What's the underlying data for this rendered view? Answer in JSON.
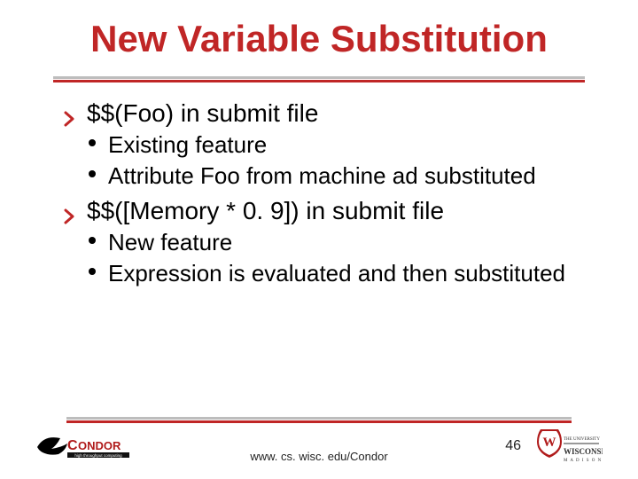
{
  "title": "New Variable Substitution",
  "bullets": [
    {
      "text": "$$(Foo) in submit file",
      "sub": [
        "Existing feature",
        "Attribute Foo from machine ad substituted"
      ]
    },
    {
      "text": "$$([Memory * 0. 9]) in submit file",
      "sub": [
        "New feature",
        "Expression is evaluated and then substituted"
      ]
    }
  ],
  "footer": {
    "url": "www. cs. wisc. edu/Condor",
    "page": "46",
    "left_logo": "condor-logo",
    "right_logo": "wisconsin-logo"
  }
}
